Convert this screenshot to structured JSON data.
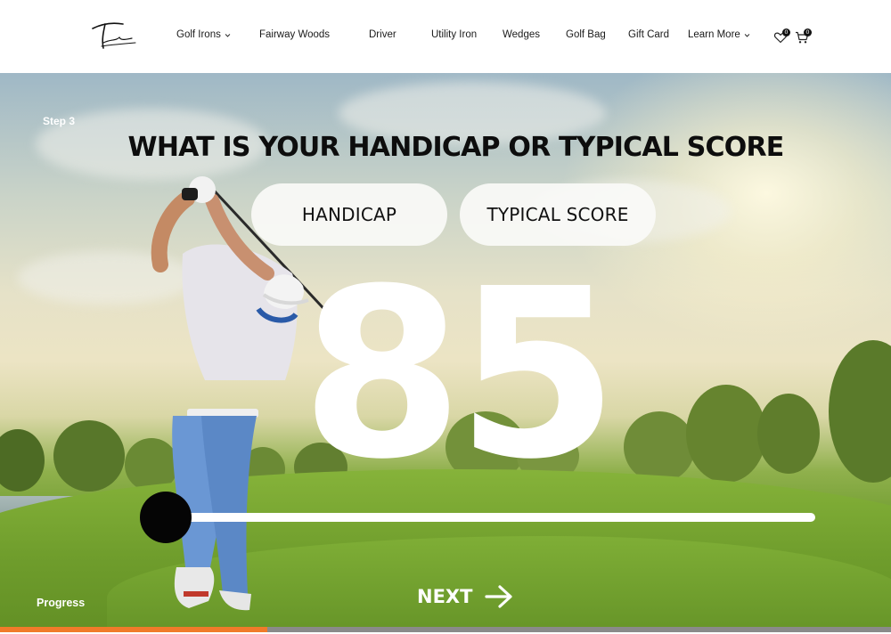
{
  "header": {
    "brand": "Takomo",
    "nav": [
      {
        "label": "Golf Irons",
        "dropdown": true
      },
      {
        "label": "Fairway Woods",
        "dropdown": false
      },
      {
        "label": "Driver",
        "dropdown": false
      },
      {
        "label": "Utility Iron",
        "dropdown": false
      },
      {
        "label": "Wedges",
        "dropdown": false
      },
      {
        "label": "Golf Bag",
        "dropdown": false
      },
      {
        "label": "Gift Card",
        "dropdown": false
      },
      {
        "label": "Learn More",
        "dropdown": true
      }
    ],
    "wishlist_count": "0",
    "cart_count": "0"
  },
  "quiz": {
    "step_label": "Step 3",
    "question": "WHAT IS YOUR HANDICAP OR TYPICAL SCORE",
    "options": [
      "HANDICAP",
      "TYPICAL SCORE"
    ],
    "value": "85",
    "slider_value": 0,
    "next_label": "NEXT",
    "progress_label": "Progress",
    "progress_fraction": 0.3
  },
  "colors": {
    "accent": "#f07b2a",
    "progress_track": "#8a8a8a",
    "slider_thumb": "#050505",
    "text_dark": "#0d0d0d"
  },
  "icons": {
    "wishlist": "heart-icon",
    "cart": "cart-icon",
    "next": "arrow-right-icon",
    "dropdown": "chevron-down-icon"
  }
}
